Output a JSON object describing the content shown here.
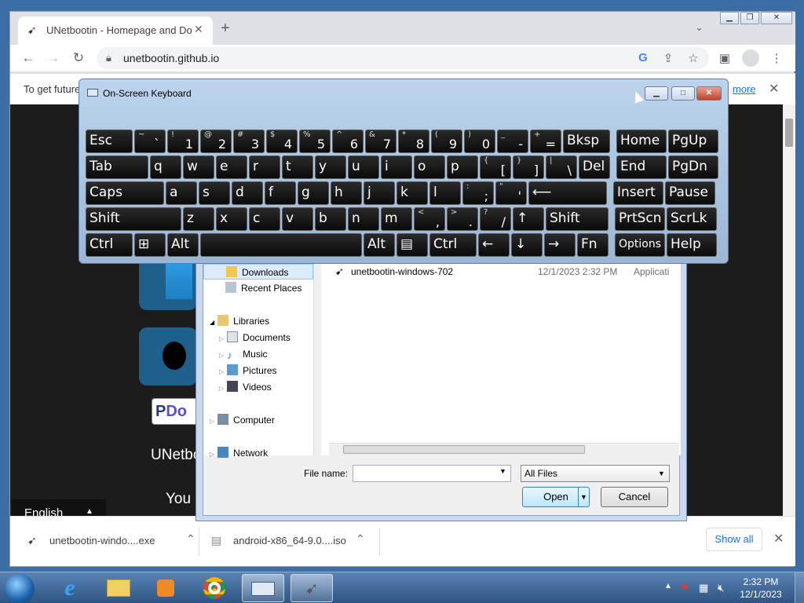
{
  "browser": {
    "tab_title": "UNetbootin - Homepage and Do",
    "new_tab": "+",
    "url": "unetbootin.github.io",
    "infobar_text": "To get future",
    "infobar_link": "more",
    "language_selector": "English",
    "language_arrow": "▲",
    "downloads": [
      {
        "name": "unetbootin-windo....exe"
      },
      {
        "name": "android-x86_64-9.0....iso"
      }
    ],
    "show_all": "Show all",
    "site_partial": {
      "donate": "Do",
      "heading": "UNetboo",
      "body": "You c"
    }
  },
  "osk": {
    "title": "On-Screen Keyboard",
    "rows": [
      [
        {
          "m": "Esc"
        },
        {
          "s": "~",
          "p": "`"
        },
        {
          "s": "!",
          "p": "1"
        },
        {
          "s": "@",
          "p": "2"
        },
        {
          "s": "#",
          "p": "3"
        },
        {
          "s": "$",
          "p": "4"
        },
        {
          "s": "%",
          "p": "5"
        },
        {
          "s": "^",
          "p": "6"
        },
        {
          "s": "&",
          "p": "7"
        },
        {
          "s": "*",
          "p": "8"
        },
        {
          "s": "(",
          "p": "9"
        },
        {
          "s": ")",
          "p": "0"
        },
        {
          "s": "_",
          "p": "-"
        },
        {
          "s": "+",
          "p": "="
        },
        {
          "m": "Bksp"
        },
        {
          "m": "Home"
        },
        {
          "m": "PgUp"
        }
      ],
      [
        {
          "m": "Tab"
        },
        {
          "m": "q"
        },
        {
          "m": "w"
        },
        {
          "m": "e"
        },
        {
          "m": "r"
        },
        {
          "m": "t"
        },
        {
          "m": "y"
        },
        {
          "m": "u"
        },
        {
          "m": "i"
        },
        {
          "m": "o"
        },
        {
          "m": "p"
        },
        {
          "s": "{",
          "p": "["
        },
        {
          "s": "}",
          "p": "]"
        },
        {
          "s": "|",
          "p": "\\"
        },
        {
          "m": "Del"
        },
        {
          "m": "End"
        },
        {
          "m": "PgDn"
        }
      ],
      [
        {
          "m": "Caps"
        },
        {
          "m": "a"
        },
        {
          "m": "s"
        },
        {
          "m": "d"
        },
        {
          "m": "f"
        },
        {
          "m": "g"
        },
        {
          "m": "h"
        },
        {
          "m": "j"
        },
        {
          "m": "k"
        },
        {
          "m": "l"
        },
        {
          "s": ":",
          "p": ";"
        },
        {
          "s": "\"",
          "p": "'"
        },
        {
          "m": "⟵"
        },
        {
          "m": "Insert"
        },
        {
          "m": "Pause"
        }
      ],
      [
        {
          "m": "Shift"
        },
        {
          "m": "z"
        },
        {
          "m": "x"
        },
        {
          "m": "c"
        },
        {
          "m": "v"
        },
        {
          "m": "b"
        },
        {
          "m": "n"
        },
        {
          "m": "m"
        },
        {
          "s": "<",
          "p": ","
        },
        {
          "s": ">",
          "p": "."
        },
        {
          "s": "?",
          "p": "/"
        },
        {
          "m": "↑"
        },
        {
          "m": "Shift"
        },
        {
          "m": "PrtScn"
        },
        {
          "m": "ScrLk"
        }
      ],
      [
        {
          "m": "Ctrl"
        },
        {
          "m": "⊞"
        },
        {
          "m": "Alt"
        },
        {
          "m": ""
        },
        {
          "m": "Alt"
        },
        {
          "m": "▤"
        },
        {
          "m": "Ctrl"
        },
        {
          "m": "←"
        },
        {
          "m": "↓"
        },
        {
          "m": "→"
        },
        {
          "m": "Fn"
        },
        {
          "m": "Options"
        },
        {
          "m": "Help"
        }
      ]
    ]
  },
  "file_dialog": {
    "nav_items": [
      {
        "label": "Downloads"
      },
      {
        "label": "Recent Places"
      },
      {
        "label": "Libraries"
      },
      {
        "label": "Documents"
      },
      {
        "label": "Music"
      },
      {
        "label": "Pictures"
      },
      {
        "label": "Videos"
      },
      {
        "label": "Computer"
      },
      {
        "label": "Network"
      }
    ],
    "file": {
      "name": "unetbootin-windows-702",
      "date": "12/1/2023 2:32 PM",
      "type": "Applicati"
    },
    "file_name_label": "File name:",
    "file_name_value": "",
    "filter": "All Files",
    "open": "Open",
    "cancel": "Cancel"
  },
  "taskbar": {
    "time": "2:32 PM",
    "date": "12/1/2023"
  }
}
